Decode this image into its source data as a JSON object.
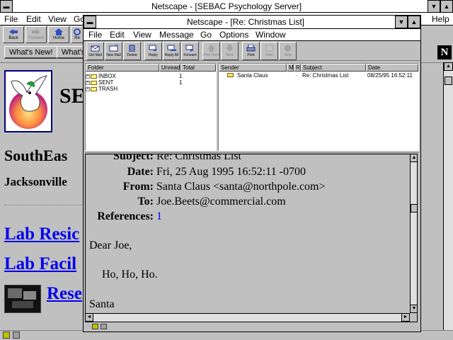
{
  "back_window": {
    "title": "Netscape - [SEBAC Psychology Server]",
    "menu": [
      "File",
      "Edit",
      "View",
      "Go",
      "Help"
    ],
    "toolbar": [
      "Back",
      "Forward",
      "Home",
      "Re"
    ],
    "directory_buttons": [
      "What's New!",
      "What's"
    ],
    "page": {
      "logo_letters": "SE",
      "heading": "SouthEas",
      "subheading": "Jacksonville",
      "links": [
        "Lab Resic",
        "Lab Facil",
        "Rese"
      ]
    },
    "netscape_logo": "N"
  },
  "mail_window": {
    "title": "Netscape - [Re: Christmas List]",
    "menu": [
      "File",
      "Edit",
      "View",
      "Message",
      "Go",
      "Options",
      "Window"
    ],
    "toolbar": [
      {
        "label": "Get Mail",
        "enabled": true
      },
      {
        "label": "New Mail",
        "enabled": true
      },
      {
        "label": "Delete",
        "enabled": true
      },
      {
        "label": "Reply",
        "enabled": true
      },
      {
        "label": "Reply All",
        "enabled": true
      },
      {
        "label": "Forward",
        "enabled": true
      },
      {
        "label": "Prev Unrd",
        "enabled": false
      },
      {
        "label": "Next",
        "enabled": false
      },
      {
        "label": "Print",
        "enabled": true
      },
      {
        "label": "Find",
        "enabled": false
      },
      {
        "label": "Stop",
        "enabled": false
      }
    ],
    "folder_columns": [
      "Folder",
      "Unread",
      "Total"
    ],
    "folders": [
      {
        "name": "INBOX",
        "unread": "",
        "total": "1"
      },
      {
        "name": "SENT",
        "unread": "",
        "total": "1"
      },
      {
        "name": "TRASH",
        "unread": "",
        "total": ""
      }
    ],
    "message_columns": [
      "Sender",
      "M",
      "R",
      "Subject",
      "Date"
    ],
    "messages": [
      {
        "sender": "Santa Claus",
        "subject": "Re: Christmas List",
        "date": "08/25/95 16:52:11"
      }
    ],
    "message": {
      "subject_label": "Subject:",
      "subject": "Re: Christmas List",
      "date_label": "Date:",
      "date": "Fri, 25 Aug 1995 16:52:11 -0700",
      "from_label": "From:",
      "from": "Santa Claus <santa@northpole.com>",
      "to_label": "To:",
      "to": "Joe.Beets@commercial.com",
      "references_label": "References:",
      "references": "1",
      "greeting": "Dear Joe,",
      "body": "Ho, Ho, Ho.",
      "signature": "Santa"
    }
  }
}
